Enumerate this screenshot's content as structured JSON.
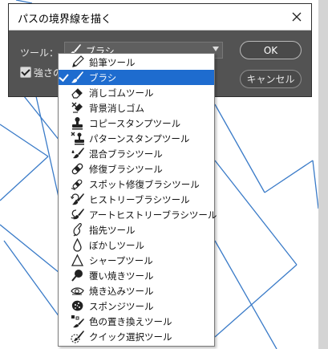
{
  "dialog": {
    "title": "パスの境界線を描く",
    "tool_label": "ツール：",
    "selected_tool": "ブラシ",
    "pressure_label": "強さのシミュレート",
    "ok_label": "OK",
    "cancel_label": "キャンセル"
  },
  "dropdown": {
    "items": [
      {
        "label": "鉛筆ツール",
        "icon": "pencil-icon"
      },
      {
        "label": "ブラシ",
        "icon": "brush-icon",
        "selected": true
      },
      {
        "label": "消しゴムツール",
        "icon": "eraser-icon"
      },
      {
        "label": "背景消しゴム",
        "icon": "background-eraser-icon"
      },
      {
        "label": "コピースタンプツール",
        "icon": "clone-stamp-icon"
      },
      {
        "label": "パターンスタンプツール",
        "icon": "pattern-stamp-icon"
      },
      {
        "label": "混合ブラシツール",
        "icon": "mixer-brush-icon"
      },
      {
        "label": "修復ブラシツール",
        "icon": "healing-brush-icon"
      },
      {
        "label": "スポット修復ブラシツール",
        "icon": "spot-healing-brush-icon"
      },
      {
        "label": "ヒストリーブラシツール",
        "icon": "history-brush-icon"
      },
      {
        "label": "アートヒストリーブラシツール",
        "icon": "art-history-brush-icon"
      },
      {
        "label": "指先ツール",
        "icon": "smudge-icon"
      },
      {
        "label": "ぼかしツール",
        "icon": "blur-drop-icon"
      },
      {
        "label": "シャープツール",
        "icon": "sharpen-triangle-icon"
      },
      {
        "label": "覆い焼きツール",
        "icon": "dodge-icon"
      },
      {
        "label": "焼き込みツール",
        "icon": "burn-hand-icon"
      },
      {
        "label": "スポンジツール",
        "icon": "sponge-icon"
      },
      {
        "label": "色の置き換えツール",
        "icon": "color-replacement-icon"
      },
      {
        "label": "クイック選択ツール",
        "icon": "quick-selection-icon"
      }
    ]
  },
  "colors": {
    "dialog_bg": "#535353",
    "highlight": "#1e6ccf",
    "path_stroke": "#3a7bc8"
  }
}
